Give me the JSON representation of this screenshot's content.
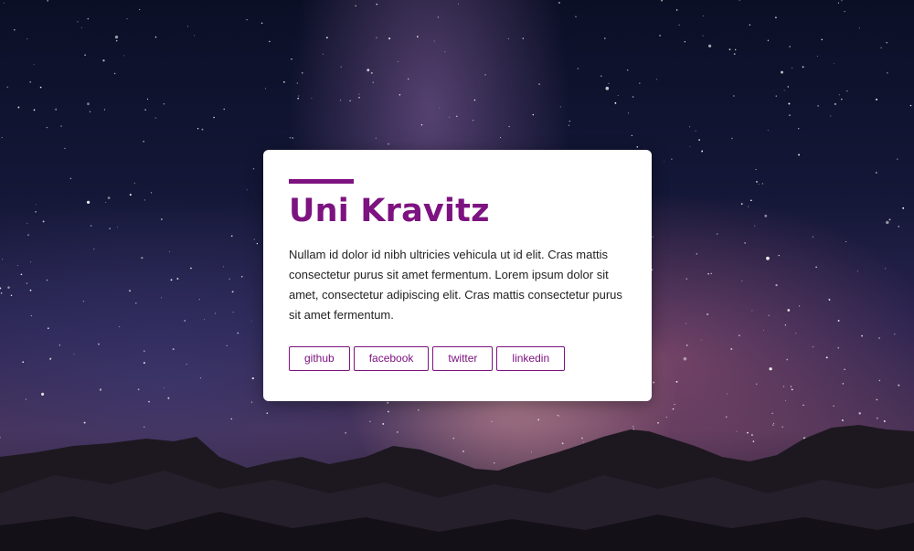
{
  "card": {
    "title": "Uni Kravitz",
    "body": "Nullam id dolor id nibh ultricies vehicula ut id elit. Cras mattis consectetur purus sit amet fermentum. Lorem ipsum dolor sit amet, consectetur adipiscing elit. Cras mattis consectetur purus sit amet fermentum.",
    "links": [
      {
        "label": "github"
      },
      {
        "label": "facebook"
      },
      {
        "label": "twitter"
      },
      {
        "label": "linkedin"
      }
    ]
  },
  "colors": {
    "accent": "#7d1380",
    "card_background": "#ffffff",
    "body_text": "#222222"
  }
}
